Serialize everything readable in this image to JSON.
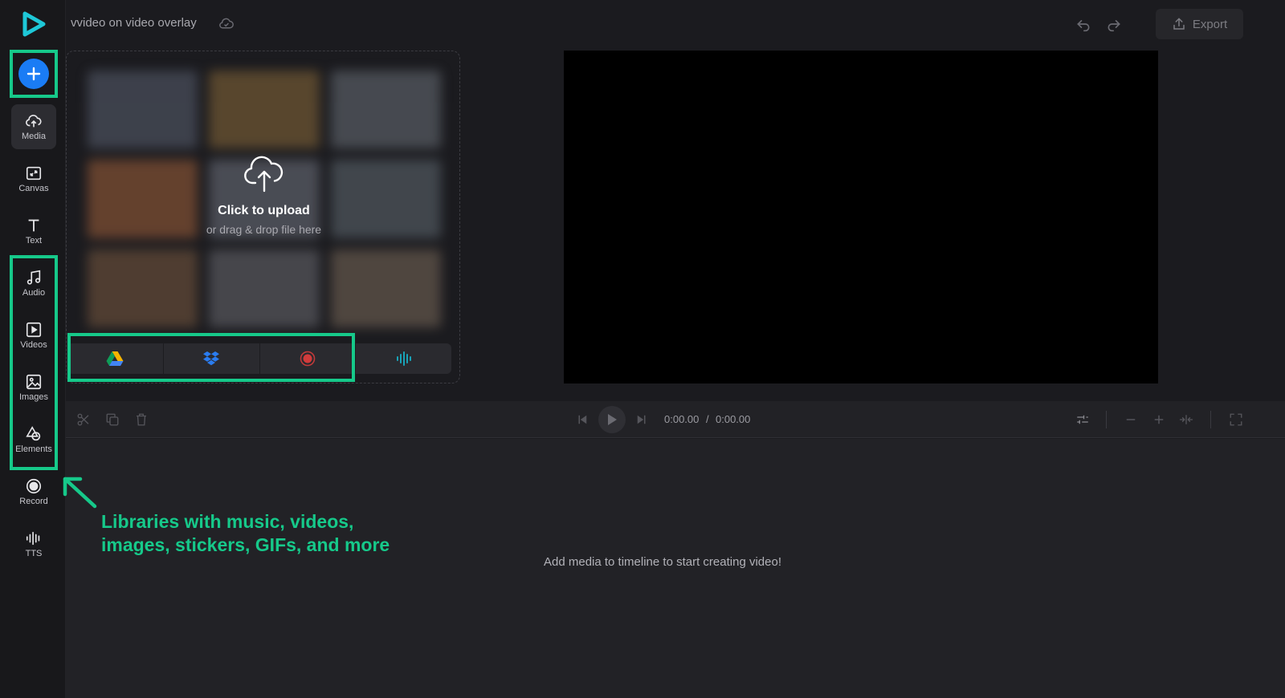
{
  "header": {
    "project_title": "vvideo on video overlay",
    "export_label": "Export"
  },
  "sidebar": {
    "items": [
      {
        "label": "Media",
        "icon": "cloud-upload-icon"
      },
      {
        "label": "Canvas",
        "icon": "canvas-icon"
      },
      {
        "label": "Text",
        "icon": "text-icon"
      },
      {
        "label": "Audio",
        "icon": "music-note-icon"
      },
      {
        "label": "Videos",
        "icon": "video-icon"
      },
      {
        "label": "Images",
        "icon": "image-icon"
      },
      {
        "label": "Elements",
        "icon": "shapes-icon"
      },
      {
        "label": "Record",
        "icon": "record-icon"
      },
      {
        "label": "TTS",
        "icon": "waveform-icon"
      }
    ],
    "active": "Media"
  },
  "upload": {
    "title": "Click to upload",
    "subtitle": "or drag & drop file here",
    "sources": [
      "google-drive-icon",
      "dropbox-icon",
      "record-icon",
      "waveform-icon"
    ]
  },
  "timeline": {
    "current_time": "0:00.00",
    "separator": "/",
    "total_time": "0:00.00",
    "empty_message": "Add media to timeline to start creating video!"
  },
  "annotation": {
    "line1": "Libraries with music, videos,",
    "line2": "images, stickers, GIFs, and more"
  },
  "colors": {
    "accent_green": "#16c98a",
    "add_button_blue": "#1a7cf5",
    "background": "#1b1b1f"
  }
}
